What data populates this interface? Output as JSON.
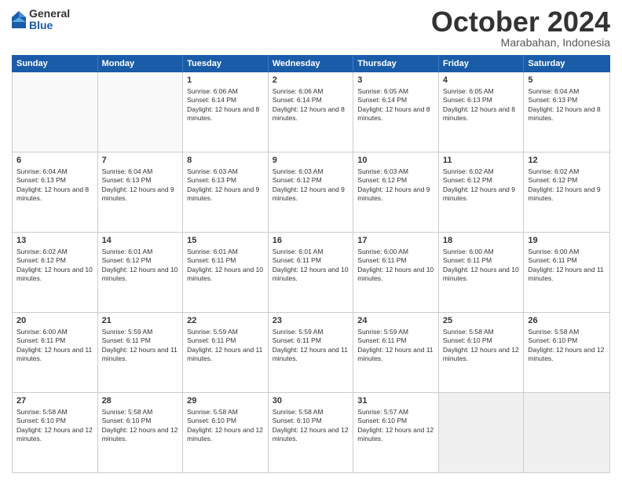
{
  "header": {
    "logo": {
      "general": "General",
      "blue": "Blue"
    },
    "month": "October 2024",
    "location": "Marabahan, Indonesia"
  },
  "weekdays": [
    "Sunday",
    "Monday",
    "Tuesday",
    "Wednesday",
    "Thursday",
    "Friday",
    "Saturday"
  ],
  "rows": [
    [
      {
        "day": "",
        "info": ""
      },
      {
        "day": "",
        "info": ""
      },
      {
        "day": "1",
        "info": "Sunrise: 6:06 AM\nSunset: 6:14 PM\nDaylight: 12 hours and 8 minutes."
      },
      {
        "day": "2",
        "info": "Sunrise: 6:06 AM\nSunset: 6:14 PM\nDaylight: 12 hours and 8 minutes."
      },
      {
        "day": "3",
        "info": "Sunrise: 6:05 AM\nSunset: 6:14 PM\nDaylight: 12 hours and 8 minutes."
      },
      {
        "day": "4",
        "info": "Sunrise: 6:05 AM\nSunset: 6:13 PM\nDaylight: 12 hours and 8 minutes."
      },
      {
        "day": "5",
        "info": "Sunrise: 6:04 AM\nSunset: 6:13 PM\nDaylight: 12 hours and 8 minutes."
      }
    ],
    [
      {
        "day": "6",
        "info": "Sunrise: 6:04 AM\nSunset: 6:13 PM\nDaylight: 12 hours and 8 minutes."
      },
      {
        "day": "7",
        "info": "Sunrise: 6:04 AM\nSunset: 6:13 PM\nDaylight: 12 hours and 9 minutes."
      },
      {
        "day": "8",
        "info": "Sunrise: 6:03 AM\nSunset: 6:13 PM\nDaylight: 12 hours and 9 minutes."
      },
      {
        "day": "9",
        "info": "Sunrise: 6:03 AM\nSunset: 6:12 PM\nDaylight: 12 hours and 9 minutes."
      },
      {
        "day": "10",
        "info": "Sunrise: 6:03 AM\nSunset: 6:12 PM\nDaylight: 12 hours and 9 minutes."
      },
      {
        "day": "11",
        "info": "Sunrise: 6:02 AM\nSunset: 6:12 PM\nDaylight: 12 hours and 9 minutes."
      },
      {
        "day": "12",
        "info": "Sunrise: 6:02 AM\nSunset: 6:12 PM\nDaylight: 12 hours and 9 minutes."
      }
    ],
    [
      {
        "day": "13",
        "info": "Sunrise: 6:02 AM\nSunset: 6:12 PM\nDaylight: 12 hours and 10 minutes."
      },
      {
        "day": "14",
        "info": "Sunrise: 6:01 AM\nSunset: 6:12 PM\nDaylight: 12 hours and 10 minutes."
      },
      {
        "day": "15",
        "info": "Sunrise: 6:01 AM\nSunset: 6:11 PM\nDaylight: 12 hours and 10 minutes."
      },
      {
        "day": "16",
        "info": "Sunrise: 6:01 AM\nSunset: 6:11 PM\nDaylight: 12 hours and 10 minutes."
      },
      {
        "day": "17",
        "info": "Sunrise: 6:00 AM\nSunset: 6:11 PM\nDaylight: 12 hours and 10 minutes."
      },
      {
        "day": "18",
        "info": "Sunrise: 6:00 AM\nSunset: 6:11 PM\nDaylight: 12 hours and 10 minutes."
      },
      {
        "day": "19",
        "info": "Sunrise: 6:00 AM\nSunset: 6:11 PM\nDaylight: 12 hours and 11 minutes."
      }
    ],
    [
      {
        "day": "20",
        "info": "Sunrise: 6:00 AM\nSunset: 6:11 PM\nDaylight: 12 hours and 11 minutes."
      },
      {
        "day": "21",
        "info": "Sunrise: 5:59 AM\nSunset: 6:11 PM\nDaylight: 12 hours and 11 minutes."
      },
      {
        "day": "22",
        "info": "Sunrise: 5:59 AM\nSunset: 6:11 PM\nDaylight: 12 hours and 11 minutes."
      },
      {
        "day": "23",
        "info": "Sunrise: 5:59 AM\nSunset: 6:11 PM\nDaylight: 12 hours and 11 minutes."
      },
      {
        "day": "24",
        "info": "Sunrise: 5:59 AM\nSunset: 6:11 PM\nDaylight: 12 hours and 11 minutes."
      },
      {
        "day": "25",
        "info": "Sunrise: 5:58 AM\nSunset: 6:10 PM\nDaylight: 12 hours and 12 minutes."
      },
      {
        "day": "26",
        "info": "Sunrise: 5:58 AM\nSunset: 6:10 PM\nDaylight: 12 hours and 12 minutes."
      }
    ],
    [
      {
        "day": "27",
        "info": "Sunrise: 5:58 AM\nSunset: 6:10 PM\nDaylight: 12 hours and 12 minutes."
      },
      {
        "day": "28",
        "info": "Sunrise: 5:58 AM\nSunset: 6:10 PM\nDaylight: 12 hours and 12 minutes."
      },
      {
        "day": "29",
        "info": "Sunrise: 5:58 AM\nSunset: 6:10 PM\nDaylight: 12 hours and 12 minutes."
      },
      {
        "day": "30",
        "info": "Sunrise: 5:58 AM\nSunset: 6:10 PM\nDaylight: 12 hours and 12 minutes."
      },
      {
        "day": "31",
        "info": "Sunrise: 5:57 AM\nSunset: 6:10 PM\nDaylight: 12 hours and 12 minutes."
      },
      {
        "day": "",
        "info": ""
      },
      {
        "day": "",
        "info": ""
      }
    ]
  ]
}
